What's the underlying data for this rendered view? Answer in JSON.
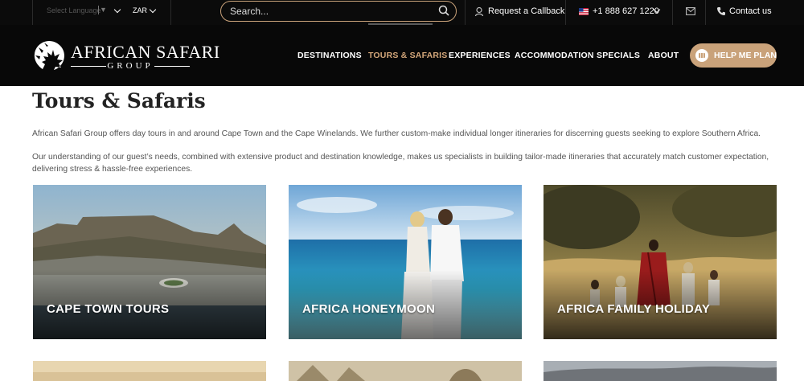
{
  "topbar": {
    "language": "Select Language",
    "currency": "ZAR",
    "search_placeholder": "Search...",
    "callback_label": "Request a Callback",
    "phone": "+1 888 627 1220",
    "contact_label": "Contact us"
  },
  "logo": {
    "title": "AFRICAN SAFARI",
    "subtitle": "GROUP"
  },
  "nav": {
    "items": [
      "DESTINATIONS",
      "TOURS & SAFARIS",
      "EXPERIENCES",
      "ACCOMMODATION",
      "SPECIALS",
      "ABOUT"
    ],
    "active": "TOURS & SAFARIS",
    "cta": "HELP ME PLAN"
  },
  "page": {
    "title": "Tours & Safaris",
    "intro1": "African Safari Group offers day tours in and around Cape Town and the Cape Winelands.   We further custom-make individual longer itineraries for discerning guests seeking to explore Southern Africa.",
    "intro2": "Our understanding of our guest’s needs, combined with extensive product and destination knowledge, makes us specialists in building tailor-made itineraries that accurately match customer expectation, delivering stress & hassle-free experiences."
  },
  "cards": [
    {
      "label": "CAPE TOWN TOURS"
    },
    {
      "label": "AFRICA HONEYMOON"
    },
    {
      "label": "AFRICA FAMILY HOLIDAY"
    }
  ],
  "colors": {
    "accent": "#c9a27a",
    "nav_active": "#d4a77a",
    "header_bg": "#080808"
  }
}
